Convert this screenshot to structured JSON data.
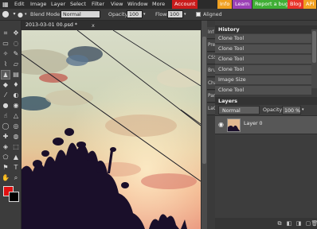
{
  "menu": {
    "logo_icon": "pixlr-logo-icon",
    "items": [
      "Edit",
      "Image",
      "Layer",
      "Select",
      "Filter",
      "View",
      "Window",
      "More"
    ],
    "account_label": "Account",
    "promos": [
      {
        "label": "Info",
        "bg": "#f0a020",
        "fg": "#ffffff"
      },
      {
        "label": "Learn",
        "bg": "#9b3fb5",
        "fg": "#ffffff"
      },
      {
        "label": "Report a bug",
        "bg": "#3fae35",
        "fg": "#ffffff"
      },
      {
        "label": "Blog",
        "bg": "#e8332a",
        "fg": "#ffffff"
      },
      {
        "label": "API",
        "bg": "#f0a020",
        "fg": "#ffffff"
      }
    ]
  },
  "options": {
    "blend_label": "Blend Mode:",
    "blend_value": "Normal",
    "opacity_label": "Opacity:",
    "opacity_value": "100 %",
    "flow_label": "Flow:",
    "flow_value": "100 %",
    "aligned_label": "Aligned"
  },
  "document": {
    "tab_title": "2013-03-01 00.psd *",
    "close_glyph": "x"
  },
  "side_tabs": [
    "Inf",
    "Pre",
    "CSS",
    "Bru",
    "Cha",
    "Par",
    "LaC"
  ],
  "history": {
    "title": "History",
    "items": [
      "Clone Tool",
      "Clone Tool",
      "Clone Tool",
      "Clone Tool",
      "Image Size",
      "Clone Tool"
    ]
  },
  "layers": {
    "title": "Layers",
    "blend_value": "Normal",
    "opacity_label": "Opacity:",
    "opacity_value": "100 %",
    "layer_name": "Layer 0"
  },
  "colors": {
    "primary": "#e01010",
    "secondary": "#000000",
    "account_bg": "#c91b1b"
  }
}
